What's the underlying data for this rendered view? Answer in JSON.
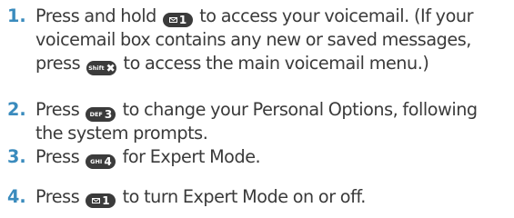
{
  "steps": [
    {
      "number": "1.",
      "lines": [
        {
          "before": "Press and hold",
          "key": {
            "sub": "✉",
            "main": "1",
            "icon": "envelope-icon"
          },
          "after": "to access your voicemail. (If your"
        },
        {
          "text": "voicemail box contains any new or saved messages,"
        },
        {
          "before": "press",
          "key": {
            "sub": "Shift",
            "main": "✖",
            "icon": "shift-x-icon"
          },
          "after": "to access the main voicemail menu.)"
        }
      ]
    },
    {
      "number": "2.",
      "lines": [
        {
          "before": "Press",
          "key": {
            "sub": "DEF",
            "main": "3"
          },
          "after": "to change your Personal Options, following"
        },
        {
          "text": "the system prompts."
        }
      ]
    },
    {
      "number": "3.",
      "lines": [
        {
          "before": "Press",
          "key": {
            "sub": "GHI",
            "main": "4"
          },
          "after": "for Expert Mode."
        }
      ]
    },
    {
      "number": "4.",
      "lines": [
        {
          "before": "Press",
          "key": {
            "sub": "✉",
            "main": "1",
            "icon": "envelope-icon"
          },
          "after": "to turn Expert Mode on or off."
        }
      ]
    }
  ],
  "colors": {
    "number": "#3a8bbd",
    "text": "#3a3a3a",
    "key_background": "#3b3b3b",
    "key_text": "#ffffff"
  }
}
